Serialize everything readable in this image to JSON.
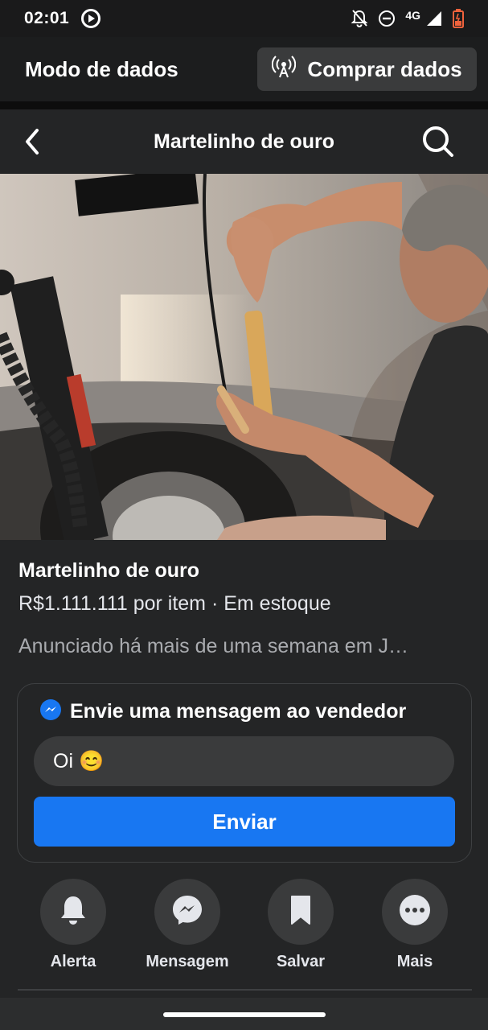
{
  "status_bar": {
    "time": "02:01",
    "network": "4G",
    "icons": [
      "play-circle-icon",
      "bell-off-icon",
      "do-not-disturb-icon",
      "signal-icon",
      "battery-low-icon"
    ]
  },
  "data_mode": {
    "title": "Modo de dados",
    "buy_label": "Comprar dados"
  },
  "nav": {
    "title": "Martelinho de ouro"
  },
  "listing": {
    "title": "Martelinho de ouro",
    "price_line": "R$1.111.111 por item · Em estoque",
    "listed_line": "Anunciado há mais de uma semana em J…"
  },
  "message": {
    "heading": "Envie uma mensagem ao vendedor",
    "input_value": "Oi 😊",
    "send_label": "Enviar"
  },
  "actions": [
    {
      "label": "Alerta",
      "icon": "bell-icon"
    },
    {
      "label": "Mensagem",
      "icon": "messenger-icon"
    },
    {
      "label": "Salvar",
      "icon": "bookmark-icon"
    },
    {
      "label": "Mais",
      "icon": "more-icon"
    }
  ],
  "colors": {
    "background": "#242526",
    "accent": "#1877f2",
    "surface": "#3a3b3c"
  }
}
